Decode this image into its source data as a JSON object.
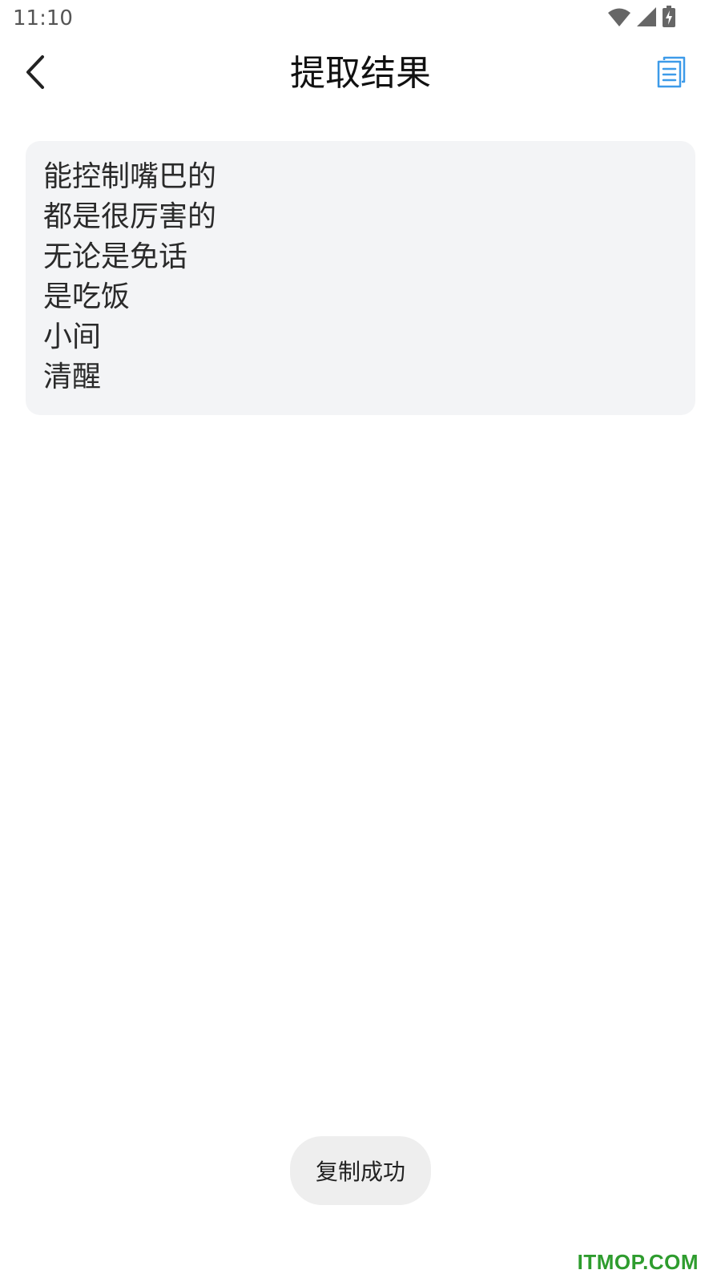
{
  "status_bar": {
    "time": "11:10",
    "icons": [
      "wifi-icon",
      "signal-icon",
      "battery-charging-icon"
    ]
  },
  "header": {
    "title": "提取结果",
    "back_icon": "chevron-left-icon",
    "copy_icon": "copy-document-icon",
    "accent_color": "#3d9be9"
  },
  "result": {
    "lines": [
      "能控制嘴巴的",
      "都是很厉害的",
      "无论是免话",
      "是吃饭",
      "小间",
      "清醒"
    ]
  },
  "toast": {
    "message": "复制成功"
  },
  "watermark": {
    "text": "ITMOP.COM",
    "color": "#2e9c2e"
  }
}
